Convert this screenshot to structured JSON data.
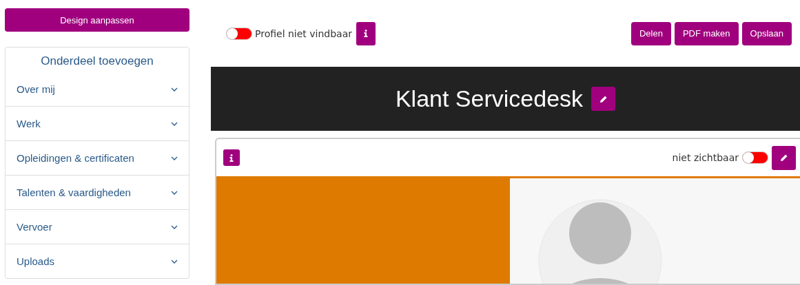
{
  "sidebar": {
    "design_button": "Design aanpassen",
    "panel_title": "Onderdeel toevoegen",
    "items": [
      {
        "label": "Over mij"
      },
      {
        "label": "Werk"
      },
      {
        "label": "Opleidingen & certificaten"
      },
      {
        "label": "Talenten & vaardigheden"
      },
      {
        "label": "Vervoer"
      },
      {
        "label": "Uploads"
      }
    ]
  },
  "toolbar": {
    "visibility_toggle": {
      "label": "Profiel niet vindbaar",
      "on": false
    },
    "buttons": [
      "Delen",
      "PDF maken",
      "Opslaan"
    ]
  },
  "banner": {
    "title": "Klant Servicedesk"
  },
  "card": {
    "visibility_toggle": {
      "label": "niet zichtbaar",
      "on": false
    }
  }
}
